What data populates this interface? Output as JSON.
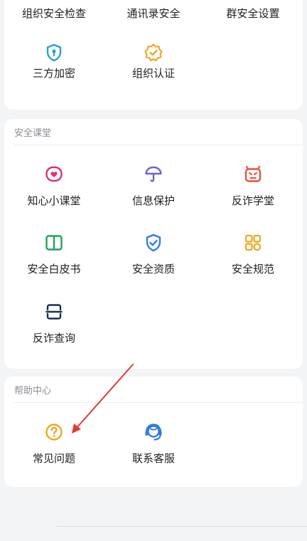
{
  "top_section": {
    "row1": [
      {
        "label": "组织安全检查"
      },
      {
        "label": "通讯录安全"
      },
      {
        "label": "群安全设置"
      }
    ],
    "row2": [
      {
        "label": "三方加密",
        "icon": "shield-lock-icon",
        "color": "#25a4c9"
      },
      {
        "label": "组织认证",
        "icon": "verified-badge-icon",
        "color": "#f0a623"
      }
    ]
  },
  "security_class": {
    "title": "安全课堂",
    "items": [
      {
        "label": "知心小课堂",
        "icon": "heart-chat-icon",
        "color": "#d6337a"
      },
      {
        "label": "信息保护",
        "icon": "umbrella-icon",
        "color": "#6c63d9"
      },
      {
        "label": "反诈学堂",
        "icon": "alert-face-icon",
        "color": "#ef4d3c"
      },
      {
        "label": "安全白皮书",
        "icon": "open-book-icon",
        "color": "#1ea35a"
      },
      {
        "label": "安全资质",
        "icon": "shield-check-icon",
        "color": "#2f7de1"
      },
      {
        "label": "安全规范",
        "icon": "grid-apps-icon",
        "color": "#f0a623"
      },
      {
        "label": "反诈查询",
        "icon": "scan-icon",
        "color": "#1f2f55"
      }
    ]
  },
  "help_center": {
    "title": "帮助中心",
    "items": [
      {
        "label": "常见问题",
        "icon": "question-circle-icon",
        "color": "#f0a623"
      },
      {
        "label": "联系客服",
        "icon": "headset-agent-icon",
        "color": "#2f7de1"
      }
    ]
  },
  "annotation": {
    "arrow_color": "#e53935"
  }
}
